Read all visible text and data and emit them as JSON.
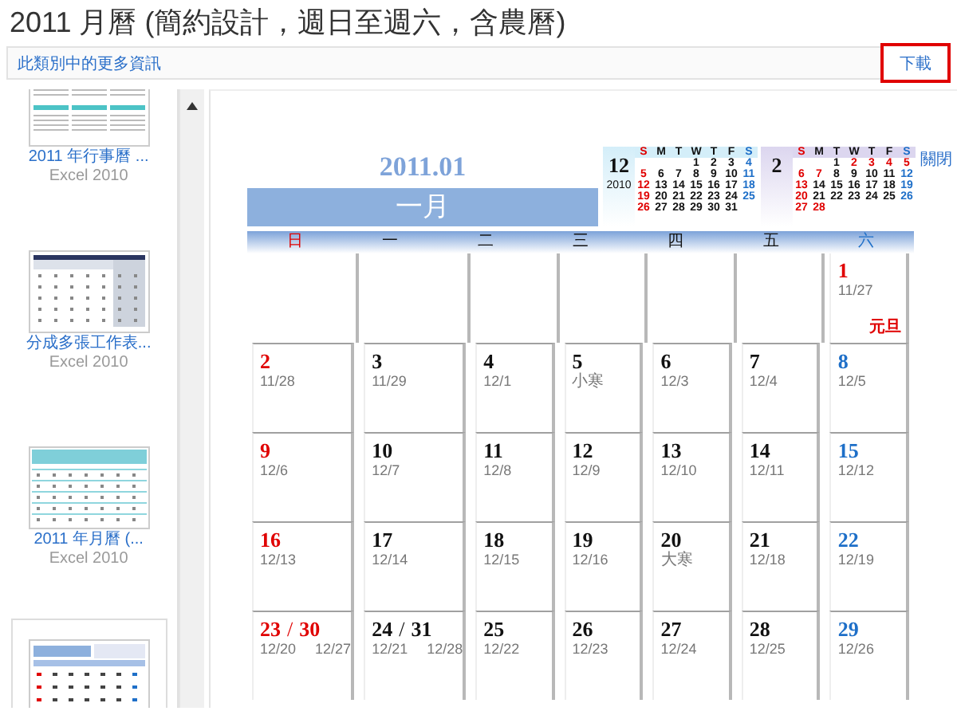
{
  "page": {
    "title": "2011 月曆 (簡約設計，週日至週六，含農曆)",
    "category_link": "此類別中的更多資訊",
    "download_button": "下載",
    "close_link": "關閉"
  },
  "sidebar": {
    "items": [
      {
        "kind": "year-grid",
        "title": "2011 年行事曆 ...",
        "app": "Excel 2010",
        "selected": false
      },
      {
        "kind": "sheet",
        "title": "分成多張工作表...",
        "app": "Excel 2010",
        "selected": false
      },
      {
        "kind": "month-teal",
        "title": "2011 年月曆 (...",
        "app": "Excel 2010",
        "selected": false
      },
      {
        "kind": "month-blue",
        "selected": true
      }
    ]
  },
  "calendar": {
    "year_month": "2011.01",
    "month_name": "一月",
    "minis": [
      {
        "month": "12",
        "year": "2010",
        "color": "#d4eef9",
        "headers": [
          {
            "label": "S",
            "color": "#e00000"
          },
          {
            "label": "M",
            "color": "#111111"
          },
          {
            "label": "T",
            "color": "#111111"
          },
          {
            "label": "W",
            "color": "#111111"
          },
          {
            "label": "T",
            "color": "#111111"
          },
          {
            "label": "F",
            "color": "#111111"
          },
          {
            "label": "S",
            "color": "#1e6fc8"
          }
        ],
        "weeks": [
          [
            {
              "kind": "blank"
            },
            {
              "kind": "blank"
            },
            {
              "kind": "blank"
            },
            {
              "kind": "day",
              "d": "1",
              "color": "#111111"
            },
            {
              "kind": "day",
              "d": "2",
              "color": "#111111"
            },
            {
              "kind": "day",
              "d": "3",
              "color": "#111111"
            },
            {
              "kind": "day",
              "d": "4",
              "color": "#1e6fc8"
            }
          ],
          [
            {
              "kind": "day",
              "d": "5",
              "color": "#e00000"
            },
            {
              "kind": "day",
              "d": "6",
              "color": "#111111"
            },
            {
              "kind": "day",
              "d": "7",
              "color": "#111111"
            },
            {
              "kind": "day",
              "d": "8",
              "color": "#111111"
            },
            {
              "kind": "day",
              "d": "9",
              "color": "#111111"
            },
            {
              "kind": "day",
              "d": "10",
              "color": "#111111"
            },
            {
              "kind": "day",
              "d": "11",
              "color": "#1e6fc8"
            }
          ],
          [
            {
              "kind": "day",
              "d": "12",
              "color": "#e00000"
            },
            {
              "kind": "day",
              "d": "13",
              "color": "#111111"
            },
            {
              "kind": "day",
              "d": "14",
              "color": "#111111"
            },
            {
              "kind": "day",
              "d": "15",
              "color": "#111111"
            },
            {
              "kind": "day",
              "d": "16",
              "color": "#111111"
            },
            {
              "kind": "day",
              "d": "17",
              "color": "#111111"
            },
            {
              "kind": "day",
              "d": "18",
              "color": "#1e6fc8"
            }
          ],
          [
            {
              "kind": "day",
              "d": "19",
              "color": "#e00000"
            },
            {
              "kind": "day",
              "d": "20",
              "color": "#111111"
            },
            {
              "kind": "day",
              "d": "21",
              "color": "#111111"
            },
            {
              "kind": "day",
              "d": "22",
              "color": "#111111"
            },
            {
              "kind": "day",
              "d": "23",
              "color": "#111111"
            },
            {
              "kind": "day",
              "d": "24",
              "color": "#111111"
            },
            {
              "kind": "day",
              "d": "25",
              "color": "#1e6fc8"
            }
          ],
          [
            {
              "kind": "day",
              "d": "26",
              "color": "#e00000"
            },
            {
              "kind": "day",
              "d": "27",
              "color": "#111111"
            },
            {
              "kind": "day",
              "d": "28",
              "color": "#111111"
            },
            {
              "kind": "day",
              "d": "29",
              "color": "#111111"
            },
            {
              "kind": "day",
              "d": "30",
              "color": "#111111"
            },
            {
              "kind": "day",
              "d": "31",
              "color": "#111111"
            }
          ]
        ]
      },
      {
        "month": "2",
        "color": "#dcd6ef",
        "headers": [
          {
            "label": "S",
            "color": "#e00000"
          },
          {
            "label": "M",
            "color": "#111111"
          },
          {
            "label": "T",
            "color": "#111111"
          },
          {
            "label": "W",
            "color": "#111111"
          },
          {
            "label": "T",
            "color": "#111111"
          },
          {
            "label": "F",
            "color": "#111111"
          },
          {
            "label": "S",
            "color": "#1e6fc8"
          }
        ],
        "weeks": [
          [
            {
              "kind": "blank"
            },
            {
              "kind": "blank"
            },
            {
              "kind": "day",
              "d": "1",
              "color": "#111111"
            },
            {
              "kind": "day",
              "d": "2",
              "color": "#e00000"
            },
            {
              "kind": "day",
              "d": "3",
              "color": "#e00000"
            },
            {
              "kind": "day",
              "d": "4",
              "color": "#e00000"
            },
            {
              "kind": "day",
              "d": "5",
              "color": "#e00000"
            }
          ],
          [
            {
              "kind": "day",
              "d": "6",
              "color": "#e00000"
            },
            {
              "kind": "day",
              "d": "7",
              "color": "#e00000"
            },
            {
              "kind": "day",
              "d": "8",
              "color": "#111111"
            },
            {
              "kind": "day",
              "d": "9",
              "color": "#111111"
            },
            {
              "kind": "day",
              "d": "10",
              "color": "#111111"
            },
            {
              "kind": "day",
              "d": "11",
              "color": "#111111"
            },
            {
              "kind": "day",
              "d": "12",
              "color": "#1e6fc8"
            }
          ],
          [
            {
              "kind": "day",
              "d": "13",
              "color": "#e00000"
            },
            {
              "kind": "day",
              "d": "14",
              "color": "#111111"
            },
            {
              "kind": "day",
              "d": "15",
              "color": "#111111"
            },
            {
              "kind": "day",
              "d": "16",
              "color": "#111111"
            },
            {
              "kind": "day",
              "d": "17",
              "color": "#111111"
            },
            {
              "kind": "day",
              "d": "18",
              "color": "#111111"
            },
            {
              "kind": "day",
              "d": "19",
              "color": "#1e6fc8"
            }
          ],
          [
            {
              "kind": "day",
              "d": "20",
              "color": "#e00000"
            },
            {
              "kind": "day",
              "d": "21",
              "color": "#111111"
            },
            {
              "kind": "day",
              "d": "22",
              "color": "#111111"
            },
            {
              "kind": "day",
              "d": "23",
              "color": "#111111"
            },
            {
              "kind": "day",
              "d": "24",
              "color": "#111111"
            },
            {
              "kind": "day",
              "d": "25",
              "color": "#111111"
            },
            {
              "kind": "day",
              "d": "26",
              "color": "#1e6fc8"
            }
          ],
          [
            {
              "kind": "day",
              "d": "27",
              "color": "#e00000"
            },
            {
              "kind": "day",
              "d": "28",
              "color": "#e00000"
            }
          ]
        ]
      }
    ],
    "weekdays": [
      {
        "label": "日",
        "color": "#e00000"
      },
      {
        "label": "一",
        "color": "#111111"
      },
      {
        "label": "二",
        "color": "#111111"
      },
      {
        "label": "三",
        "color": "#111111"
      },
      {
        "label": "四",
        "color": "#111111"
      },
      {
        "label": "五",
        "color": "#111111"
      },
      {
        "label": "六",
        "color": "#1e6fc8"
      }
    ],
    "weeks": [
      [
        {
          "kind": "blank"
        },
        {
          "kind": "blank"
        },
        {
          "kind": "blank"
        },
        {
          "kind": "blank"
        },
        {
          "kind": "blank"
        },
        {
          "kind": "blank"
        },
        {
          "kind": "day",
          "day": "1",
          "lunar": "11/27",
          "holiday": "元旦",
          "color": "#e00000"
        }
      ],
      [
        {
          "kind": "day",
          "day": "2",
          "lunar": "11/28",
          "color": "#e00000"
        },
        {
          "kind": "day",
          "day": "3",
          "lunar": "11/29",
          "color": "#111111"
        },
        {
          "kind": "day",
          "day": "4",
          "lunar": "12/1",
          "color": "#111111"
        },
        {
          "kind": "day",
          "day": "5",
          "lunar": "小寒",
          "color": "#111111"
        },
        {
          "kind": "day",
          "day": "6",
          "lunar": "12/3",
          "color": "#111111"
        },
        {
          "kind": "day",
          "day": "7",
          "lunar": "12/4",
          "color": "#111111"
        },
        {
          "kind": "day",
          "day": "8",
          "lunar": "12/5",
          "color": "#1e6fc8"
        }
      ],
      [
        {
          "kind": "day",
          "day": "9",
          "lunar": "12/6",
          "color": "#e00000"
        },
        {
          "kind": "day",
          "day": "10",
          "lunar": "12/7",
          "color": "#111111"
        },
        {
          "kind": "day",
          "day": "11",
          "lunar": "12/8",
          "color": "#111111"
        },
        {
          "kind": "day",
          "day": "12",
          "lunar": "12/9",
          "color": "#111111"
        },
        {
          "kind": "day",
          "day": "13",
          "lunar": "12/10",
          "color": "#111111"
        },
        {
          "kind": "day",
          "day": "14",
          "lunar": "12/11",
          "color": "#111111"
        },
        {
          "kind": "day",
          "day": "15",
          "lunar": "12/12",
          "color": "#1e6fc8"
        }
      ],
      [
        {
          "kind": "day",
          "day": "16",
          "lunar": "12/13",
          "color": "#e00000"
        },
        {
          "kind": "day",
          "day": "17",
          "lunar": "12/14",
          "color": "#111111"
        },
        {
          "kind": "day",
          "day": "18",
          "lunar": "12/15",
          "color": "#111111"
        },
        {
          "kind": "day",
          "day": "19",
          "lunar": "12/16",
          "color": "#111111"
        },
        {
          "kind": "day",
          "day": "20",
          "lunar": "大寒",
          "color": "#111111"
        },
        {
          "kind": "day",
          "day": "21",
          "lunar": "12/18",
          "color": "#111111"
        },
        {
          "kind": "day",
          "day": "22",
          "lunar": "12/19",
          "color": "#1e6fc8"
        }
      ],
      [
        {
          "kind": "double",
          "day": "23",
          "lunar": "12/20",
          "separator": "/",
          "day2": "30",
          "lunar2": "12/27",
          "color": "#e00000"
        },
        {
          "kind": "double",
          "day": "24",
          "lunar": "12/21",
          "separator": "/",
          "day2": "31",
          "lunar2": "12/28",
          "color": "#111111"
        },
        {
          "kind": "day",
          "day": "25",
          "lunar": "12/22",
          "color": "#111111"
        },
        {
          "kind": "day",
          "day": "26",
          "lunar": "12/23",
          "color": "#111111"
        },
        {
          "kind": "day",
          "day": "27",
          "lunar": "12/24",
          "color": "#111111"
        },
        {
          "kind": "day",
          "day": "28",
          "lunar": "12/25",
          "color": "#111111"
        },
        {
          "kind": "day",
          "day": "29",
          "lunar": "12/26",
          "color": "#1e6fc8"
        }
      ]
    ]
  }
}
